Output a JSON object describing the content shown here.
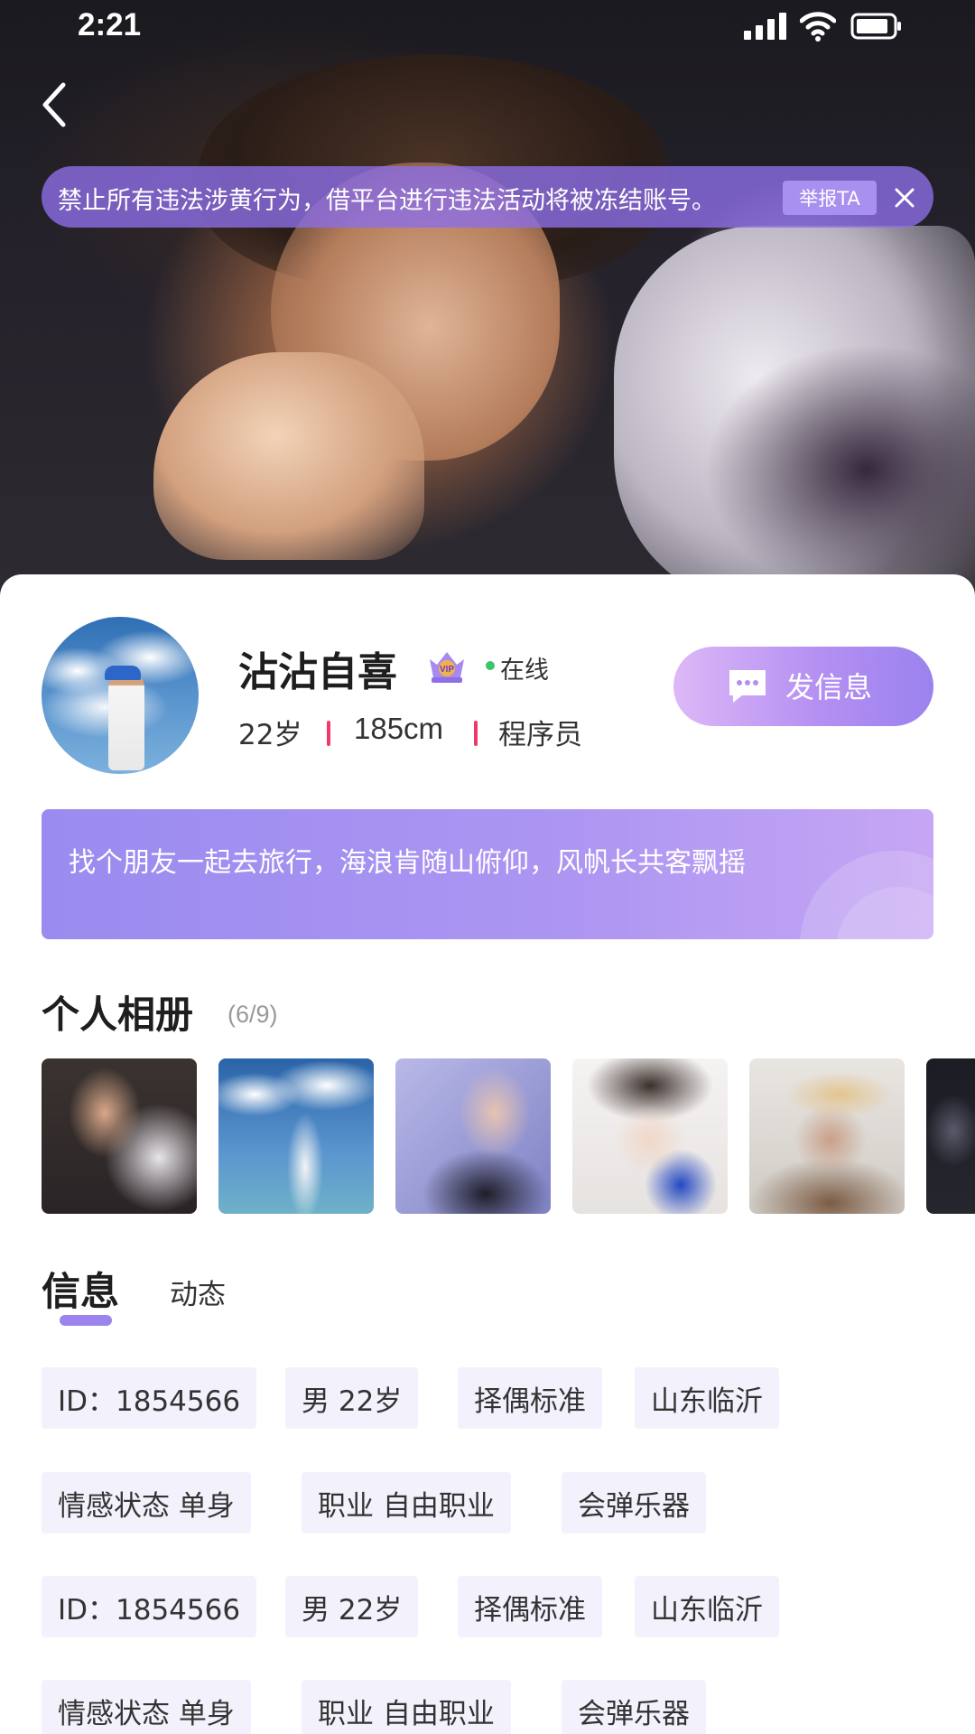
{
  "status_bar": {
    "time": "2:21"
  },
  "warning": {
    "text": "禁止所有违法涉黄行为，借平台进行违法活动将被冻结账号。",
    "report_label": "举报TA"
  },
  "profile": {
    "name": "沾沾自喜",
    "vip_badge": "VIP",
    "online_label": "在线",
    "age": "22岁",
    "height": "185cm",
    "job": "程序员",
    "message_button_label": "发信息",
    "bio": "找个朋友一起去旅行，海浪肯随山俯仰，风帆长共客飘摇"
  },
  "album": {
    "title": "个人相册",
    "count": "(6/9)"
  },
  "tabs": {
    "info": "信息",
    "moments": "动态"
  },
  "tags": {
    "row1": [
      "ID：1854566",
      "男   22岁",
      "择偶标准",
      "山东临沂"
    ],
    "row2": [
      "情感状态   单身",
      "职业   自由职业",
      "会弹乐器"
    ],
    "row3": [
      "ID：1854566",
      "男   22岁",
      "择偶标准",
      "山东临沂"
    ],
    "row4": [
      "情感状态   单身",
      "职业   自由职业",
      "会弹乐器"
    ]
  },
  "colors": {
    "accent": "#9b84ee",
    "separator": "#f0396b",
    "online": "#3cc56a",
    "tag_bg": "#f3f1fb"
  }
}
